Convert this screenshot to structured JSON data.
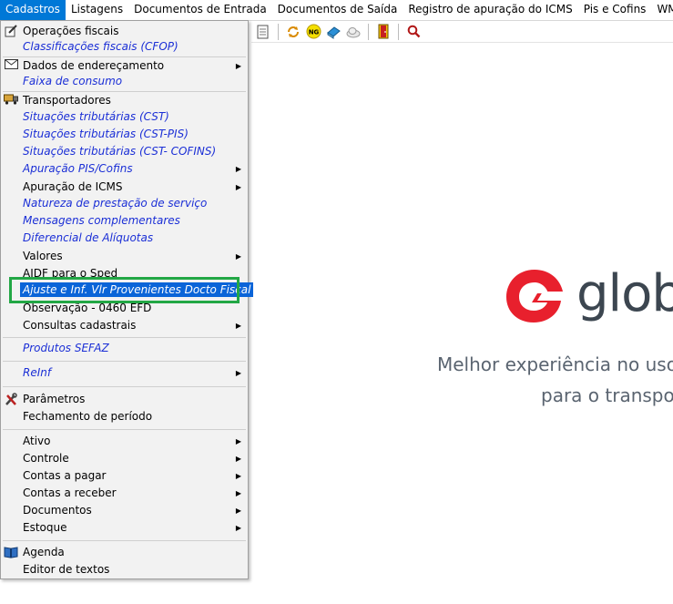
{
  "menubar": {
    "items": [
      "Cadastros",
      "Listagens",
      "Documentos de Entrada",
      "Documentos de Saída",
      "Registro de apuração do ICMS",
      "Pis e Cofins",
      "WMS - Controle"
    ]
  },
  "menu": {
    "items": [
      {
        "label": "Operações fiscais",
        "icon": "pencil-doc-icon"
      },
      {
        "label": "Classificações fiscais (CFOP)"
      },
      {
        "label": "Dados de endereçamento",
        "icon": "envelope-icon"
      },
      {
        "label": "Faixa de consumo"
      },
      {
        "label": "Transportadores",
        "icon": "truck-icon"
      },
      {
        "label": "Situações tributárias (CST)"
      },
      {
        "label": "Situações tributárias (CST-PIS)"
      },
      {
        "label": "Situações tributárias (CST- COFINS)"
      },
      {
        "label": "Apuração PIS/Cofins"
      },
      {
        "label": "Apuração de ICMS"
      },
      {
        "label": "Natureza de prestação de serviço"
      },
      {
        "label": "Mensagens complementares"
      },
      {
        "label": "Diferencial de Alíquotas"
      },
      {
        "label": "Valores"
      },
      {
        "label": "AIDF para o Sped"
      },
      {
        "label": "Ajuste e Inf. Vlr Provenientes Docto Fiscal"
      },
      {
        "label": "Observação - 0460 EFD"
      },
      {
        "label": "Consultas cadastrais"
      },
      {
        "label": "Produtos SEFAZ"
      },
      {
        "label": "ReInf"
      },
      {
        "label": "Parâmetros",
        "icon": "tools-icon"
      },
      {
        "label": "Fechamento de período"
      },
      {
        "label": "Ativo"
      },
      {
        "label": "Controle"
      },
      {
        "label": "Contas a pagar"
      },
      {
        "label": "Contas a receber"
      },
      {
        "label": "Documentos"
      },
      {
        "label": "Estoque"
      },
      {
        "label": "Agenda",
        "icon": "book-icon"
      },
      {
        "label": "Editor de textos"
      }
    ]
  },
  "toolbar": {
    "ng_label": "NG"
  },
  "brand": {
    "logo_text": "glob",
    "tagline_1": "Melhor experiência no uso",
    "tagline_2": "para o transpo",
    "accent": "#e8202d"
  }
}
